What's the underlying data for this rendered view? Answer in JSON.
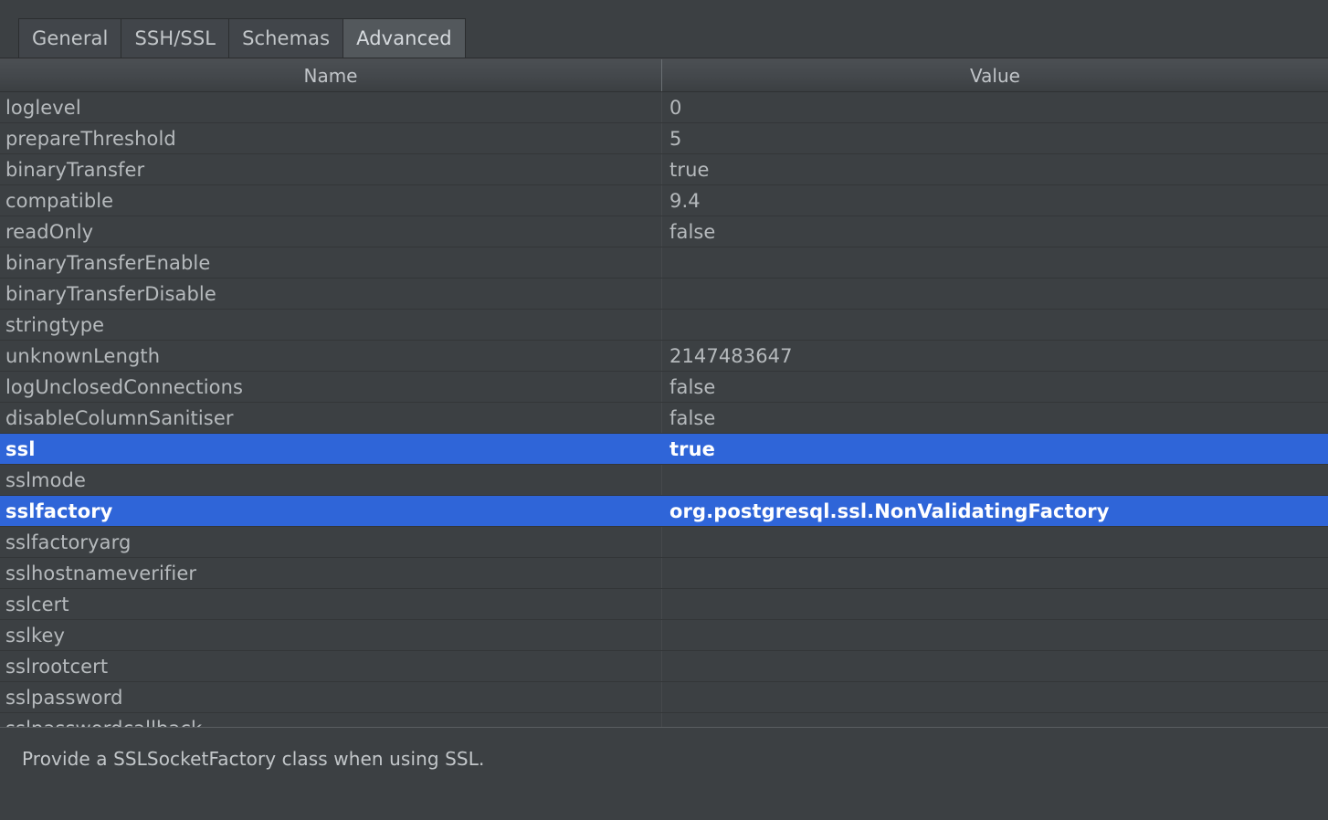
{
  "tabs": [
    {
      "label": "General",
      "selected": false
    },
    {
      "label": "SSH/SSL",
      "selected": false
    },
    {
      "label": "Schemas",
      "selected": false
    },
    {
      "label": "Advanced",
      "selected": true
    }
  ],
  "table": {
    "columns": [
      {
        "header": "Name",
        "key": "name"
      },
      {
        "header": "Value",
        "key": "value"
      }
    ],
    "rows": [
      {
        "name": "loglevel",
        "value": "0",
        "selected": false
      },
      {
        "name": "prepareThreshold",
        "value": "5",
        "selected": false
      },
      {
        "name": "binaryTransfer",
        "value": "true",
        "selected": false
      },
      {
        "name": "compatible",
        "value": "9.4",
        "selected": false
      },
      {
        "name": "readOnly",
        "value": "false",
        "selected": false
      },
      {
        "name": "binaryTransferEnable",
        "value": "",
        "selected": false
      },
      {
        "name": "binaryTransferDisable",
        "value": "",
        "selected": false
      },
      {
        "name": "stringtype",
        "value": "",
        "selected": false
      },
      {
        "name": "unknownLength",
        "value": "2147483647",
        "selected": false
      },
      {
        "name": "logUnclosedConnections",
        "value": "false",
        "selected": false
      },
      {
        "name": "disableColumnSanitiser",
        "value": "false",
        "selected": false
      },
      {
        "name": "ssl",
        "value": "true",
        "selected": true
      },
      {
        "name": "sslmode",
        "value": "",
        "selected": false
      },
      {
        "name": "sslfactory",
        "value": "org.postgresql.ssl.NonValidatingFactory",
        "selected": true
      },
      {
        "name": "sslfactoryarg",
        "value": "",
        "selected": false
      },
      {
        "name": "sslhostnameverifier",
        "value": "",
        "selected": false
      },
      {
        "name": "sslcert",
        "value": "",
        "selected": false
      },
      {
        "name": "sslkey",
        "value": "",
        "selected": false
      },
      {
        "name": "sslrootcert",
        "value": "",
        "selected": false
      },
      {
        "name": "sslpassword",
        "value": "",
        "selected": false
      },
      {
        "name": "sslpasswordcallback",
        "value": "",
        "selected": false
      }
    ]
  },
  "description": {
    "text": "Provide a SSLSocketFactory class when using SSL."
  },
  "colors": {
    "background": "#3c4043",
    "selection": "#2f65d8",
    "selection_text": "#ffffff",
    "text": "#b6babd",
    "tab_selected_bg": "#53585c"
  }
}
